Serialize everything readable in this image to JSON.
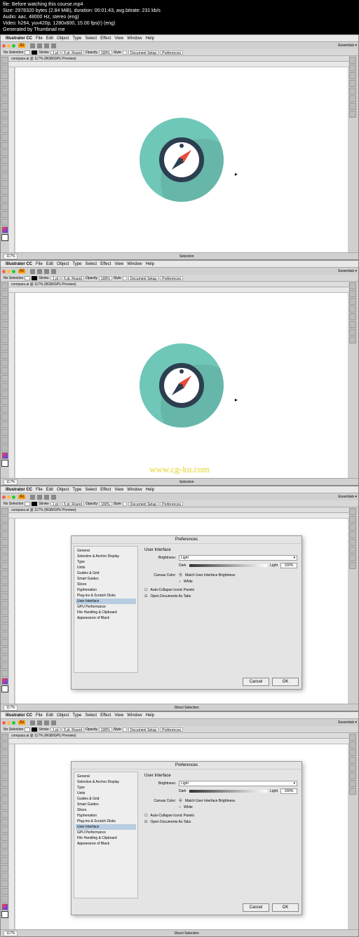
{
  "metadata": {
    "line1": "file: Before watching this course.mp4",
    "line2": "Size: 2978320 bytes (2.84 MiB), duration: 00:01:43, avg.bitrate: 231 kb/s",
    "line3": "Audio: aac, 48000 Hz, stereo (eng)",
    "line4": "Video: h264, yuv420p, 1280x800, 15.00 fps(r) (eng)",
    "line5": "Generated by Thumbnail me"
  },
  "menubar": {
    "apple": "",
    "app": "Illustrator CC",
    "items": [
      "File",
      "Edit",
      "Object",
      "Type",
      "Select",
      "Effect",
      "View",
      "Window",
      "Help"
    ]
  },
  "titlebar": {
    "ai": "Ai",
    "essentials": "Essentials ▾"
  },
  "ctrlbar": {
    "nosel": "No Selection",
    "stroke": "Stroke",
    "stroke_val": "1 pt",
    "round": "5 pt. Round",
    "opacity": "Opacity",
    "opacity_val": "100%",
    "style": "Style",
    "docsetup": "Document Setup",
    "prefs": "Preferences"
  },
  "tab": "compass.ai @ 117% (RGB/GPU Preview)",
  "status": {
    "zoom": "117%",
    "selection": "Selection",
    "direct_selection": "Direct Selection"
  },
  "watermark": "www.cg-ku.com",
  "prefs_dialog": {
    "title": "Preferences",
    "categories": [
      "General",
      "Selection & Anchor Display",
      "Type",
      "Units",
      "Guides & Grid",
      "Smart Guides",
      "Slices",
      "Hyphenation",
      "Plug-ins & Scratch Disks",
      "User Interface",
      "GPU Performance",
      "File Handling & Clipboard",
      "Appearance of Black"
    ],
    "selected_category": "User Interface",
    "section": "User Interface",
    "brightness_label": "Brightness:",
    "brightness_value": "Light",
    "slider_dark": "Dark",
    "slider_light": "Light",
    "slider_pct": "100%",
    "canvas_color_label": "Canvas Color:",
    "canvas_opt1": "Match User Interface Brightness",
    "canvas_opt2": "White",
    "auto_collapse": "Auto-Collapse Iconic Panels",
    "open_tabs": "Open Documents As Tabs",
    "cancel": "Cancel",
    "ok": "OK"
  }
}
